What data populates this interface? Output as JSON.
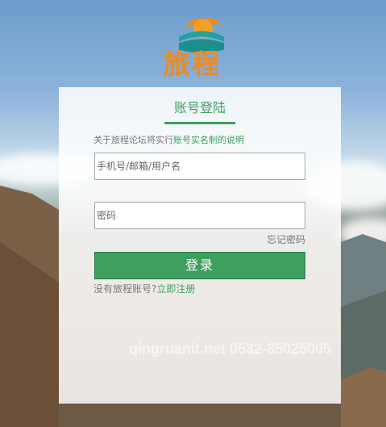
{
  "brand": {
    "logo_text": "旅程",
    "logo_icon": "sun-over-waves-icon",
    "colors": {
      "orange": "#f08a1c",
      "teal": "#1ea3a0"
    }
  },
  "login": {
    "title": "账号登陆",
    "notice_prefix": "关于旅程论坛将实行",
    "notice_link": "账号实名制的说明",
    "username_placeholder": "手机号/邮箱/用户名",
    "password_placeholder": "密码",
    "forgot_password": "忘记密码",
    "submit_label": "登录",
    "register_prompt": "没有旅程账号?",
    "register_link": "立即注册",
    "accent_color": "#3f9f5f"
  },
  "watermark": "qingruanit.net 0532-85025005"
}
